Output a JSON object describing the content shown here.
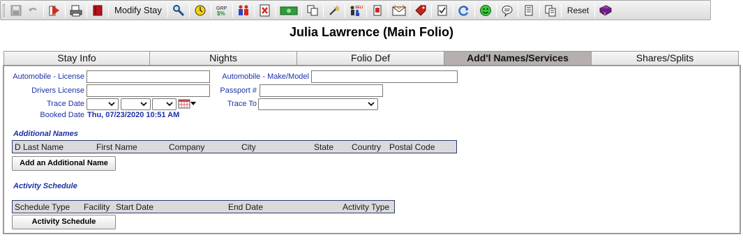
{
  "toolbar": {
    "modify_stay_label": "Modify Stay",
    "reset_label": "Reset",
    "icons": [
      "save-icon",
      "undo-icon",
      "checkout-icon",
      "print-icon",
      "book-icon",
      "search-icon",
      "clock-icon",
      "grp-icon",
      "people-icon",
      "cancel-icon",
      "money-icon",
      "copy-icon",
      "magic-icon",
      "sell-icon",
      "card-icon",
      "mail-icon",
      "tag-icon",
      "checklist-icon",
      "refresh-icon",
      "smiley-icon",
      "speech-icon",
      "scroll-icon",
      "documents-icon",
      "ledger-icon"
    ]
  },
  "title": "Julia Lawrence (Main Folio)",
  "tabs": [
    {
      "label": "Stay Info"
    },
    {
      "label": "Nights"
    },
    {
      "label": "Folio Def"
    },
    {
      "label": "Add'l Names/Services"
    },
    {
      "label": "Shares/Splits"
    }
  ],
  "form": {
    "auto_license_label": "Automobile - License",
    "auto_license_value": "",
    "auto_make_label": "Automobile - Make/Model",
    "auto_make_value": "",
    "drivers_license_label": "Drivers License",
    "drivers_license_value": "",
    "passport_label": "Passport #",
    "passport_value": "",
    "trace_date_label": "Trace Date",
    "trace_to_label": "Trace To",
    "booked_date_label": "Booked Date",
    "booked_date_value": "Thu, 07/23/2020 10:51 AM"
  },
  "additional_names": {
    "title": "Additional Names",
    "columns": [
      "D",
      "Last Name",
      "First Name",
      "Company",
      "City",
      "State",
      "Country",
      "Postal Code"
    ],
    "add_button": "Add an Additional Name"
  },
  "activity_schedule": {
    "title": "Activity Schedule",
    "columns": [
      "Schedule Type",
      "Facility",
      "Start Date",
      "End Date",
      "Activity Type"
    ],
    "button": "Activity Schedule"
  },
  "colors": {
    "label_blue": "#1a31a8",
    "active_tab": "#b5b0ad",
    "grid_header": "#dadada"
  }
}
